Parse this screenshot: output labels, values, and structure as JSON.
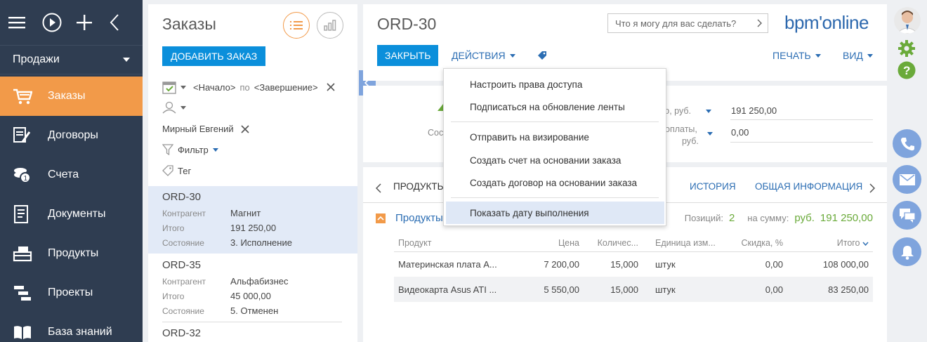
{
  "colors": {
    "nav_bg": "#2f3d51",
    "accent_orange": "#f29a49",
    "primary_blue": "#0b8fdb",
    "link_blue": "#2b6db3",
    "green": "#6aaa3a",
    "comm_blue": "#7fa4dd"
  },
  "nav": {
    "section": "Продажи",
    "items": [
      {
        "label": "Заказы",
        "icon": "cart-icon",
        "active": true
      },
      {
        "label": "Договоры",
        "icon": "contract-icon"
      },
      {
        "label": "Счета",
        "icon": "coins-icon"
      },
      {
        "label": "Документы",
        "icon": "document-icon"
      },
      {
        "label": "Продукты",
        "icon": "products-icon"
      },
      {
        "label": "Проекты",
        "icon": "projects-icon"
      },
      {
        "label": "База знаний",
        "icon": "book-icon"
      }
    ]
  },
  "list": {
    "title": "Заказы",
    "add_button": "ДОБАВИТЬ ЗАКАЗ",
    "period_start": "<Начало>",
    "period_by": "по",
    "period_end": "<Завершение>",
    "owner": "Мирный Евгений",
    "filter": "Фильтр",
    "tag": "Тег",
    "records": [
      {
        "title": "ORD-30",
        "fields": [
          {
            "k": "Контрагент",
            "v": "Магнит"
          },
          {
            "k": "Итого",
            "v": "191 250,00"
          },
          {
            "k": "Состояние",
            "v": "3. Исполнение"
          }
        ]
      },
      {
        "title": "ORD-35",
        "fields": [
          {
            "k": "Контрагент",
            "v": "Альфабизнес"
          },
          {
            "k": "Итого",
            "v": "45 000,00"
          },
          {
            "k": "Состояние",
            "v": "5. Отменен"
          }
        ]
      },
      {
        "title": "ORD-32"
      }
    ]
  },
  "header": {
    "title": "ORD-30",
    "search_placeholder": "Что я могу для вас сделать?",
    "logo": "bpm'online",
    "close": "ЗАКРЫТЬ",
    "actions": "ДЕЙСТВИЯ",
    "print": "ПЕЧАТЬ",
    "view": "ВИД"
  },
  "mid": {
    "stage_label": "Сост",
    "field1_label": "ого, руб.",
    "field1_value": "191 250,00",
    "field2_label_1": "оплаты,",
    "field2_label_2": "руб.",
    "field2_value": "0,00"
  },
  "actions_menu": [
    "Настроить права доступа",
    "Подписаться на обновление ленты",
    "Отправить на визирование",
    "Создать счет на основании заказа",
    "Создать договор на основании заказа",
    "Показать дату выполнения"
  ],
  "tabs": {
    "products": "ПРОДУКТЫ",
    "history": "ИСТОРИЯ",
    "general": "ОБЩАЯ ИНФОРМАЦИЯ"
  },
  "products": {
    "group_title": "Продукты",
    "positions_label": "Позиций:",
    "positions": "2",
    "sum_label": "на сумму:",
    "currency": "руб.",
    "sum": "191 250,00",
    "columns": [
      "Продукт",
      "Цена",
      "Количес...",
      "Единица изм...",
      "Скидка, %",
      "Итого"
    ],
    "rows": [
      [
        "Материнская плата A...",
        "7 200,00",
        "15,000",
        "штук",
        "0,00",
        "108 000,00"
      ],
      [
        "Видеокарта Asus ATI ...",
        "5 550,00",
        "15,000",
        "штук",
        "0,00",
        "83 250,00"
      ]
    ]
  }
}
